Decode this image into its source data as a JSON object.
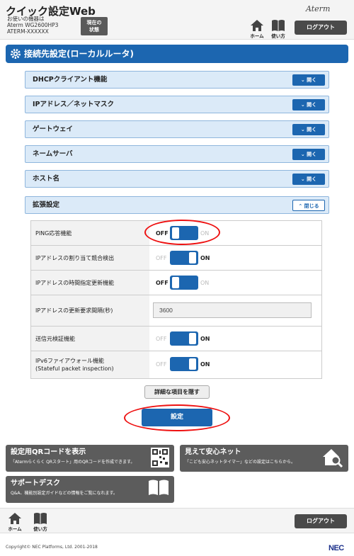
{
  "header": {
    "app_title": "クイック設定Web",
    "model_label": "お使いの機器は",
    "model_name": "Aterm WG2600HP3",
    "model_id": "ATERM-XXXXXX",
    "status_button": "現在の\n状態",
    "status_line1": "現在の",
    "status_line2": "状態",
    "brand": "Aterm",
    "nav_home": "ホーム",
    "nav_manual": "使い方",
    "logout": "ログアウト"
  },
  "section": {
    "title": "接続先設定(ローカルルータ)"
  },
  "accordions": [
    {
      "label": "DHCPクライアント機能",
      "button": "開く"
    },
    {
      "label": "IPアドレス／ネットマスク",
      "button": "開く"
    },
    {
      "label": "ゲートウェイ",
      "button": "開く"
    },
    {
      "label": "ネームサーバ",
      "button": "開く"
    },
    {
      "label": "ホスト名",
      "button": "開く"
    },
    {
      "label": "拡張設定",
      "button": "閉じる"
    }
  ],
  "settings": {
    "off_label": "OFF",
    "on_label": "ON",
    "rows": [
      {
        "label": "PING応答機能",
        "state": "OFF"
      },
      {
        "label": "IPアドレスの割り当て競合検出",
        "state": "ON"
      },
      {
        "label": "IPアドレスの時間指定更新機能",
        "state": "OFF"
      },
      {
        "label": "IPアドレスの更新要求間隔(秒)",
        "value": "3600"
      },
      {
        "label": "送信元検証機能",
        "state": "ON"
      },
      {
        "label_line1": "IPv6ファイアウォール機能",
        "label_line2": "(Stateful packet inspection)",
        "state": "ON"
      }
    ]
  },
  "buttons": {
    "hide_details": "詳細な項目を隠す",
    "apply": "設定"
  },
  "cards": {
    "qr": {
      "title": "設定用QRコードを表示",
      "desc": "「Atermらくらく QRスタート」用のQRコードを作成できます。"
    },
    "safety": {
      "title": "見えて安心ネット",
      "desc": "「こども安心ネットタイマー」などの設定はこちらから。"
    },
    "support": {
      "title": "サポートデスク",
      "desc": "Q&A、機能別設定ガイドなどの情報をご覧になれます。"
    }
  },
  "footer": {
    "nav_home": "ホーム",
    "nav_manual": "使い方",
    "logout": "ログアウト",
    "copyright": "Copyright© NEC Platforms, Ltd. 2001-2018",
    "nec": "NEC"
  },
  "colors": {
    "primary_blue": "#1c66b0",
    "accordion_bg": "#dbeaf8",
    "highlight_ring": "#e11111",
    "card_bg": "#5c5c5c"
  }
}
